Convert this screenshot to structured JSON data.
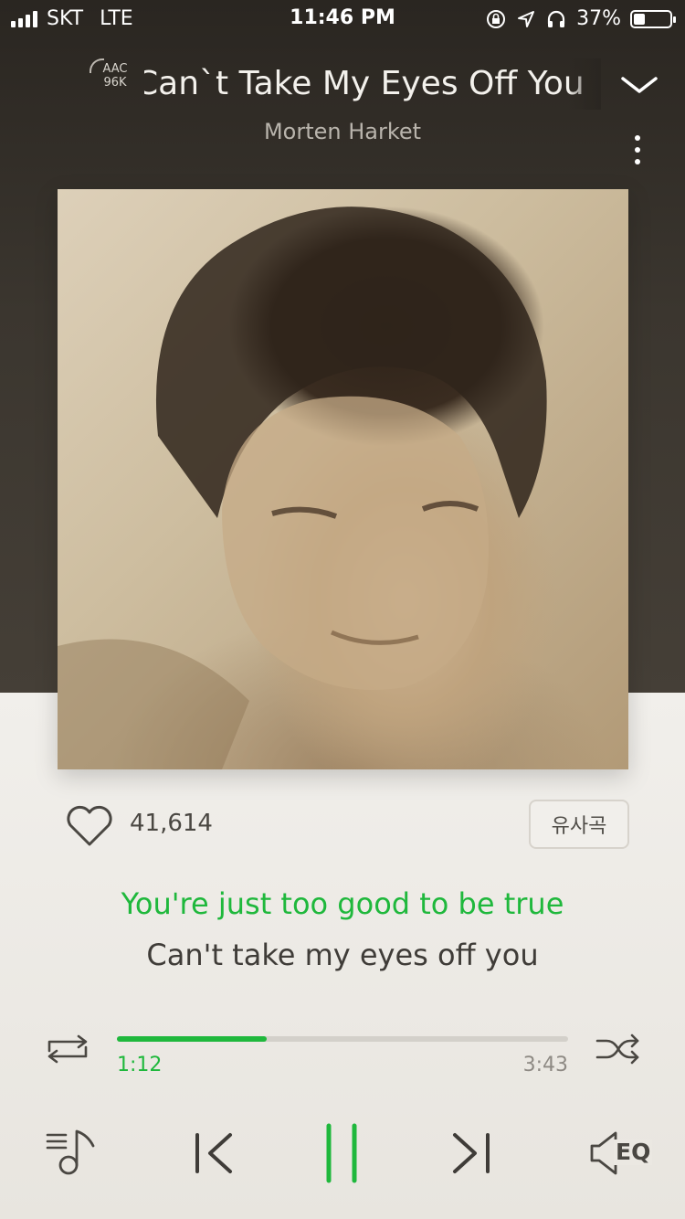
{
  "status_bar": {
    "carrier": "SKT",
    "network": "LTE",
    "time": "11:46 PM",
    "battery": "37%",
    "battery_level": 0.37,
    "icons": [
      "signal-icon",
      "rotation-lock-icon",
      "location-arrow-icon",
      "headphones-icon",
      "battery-icon"
    ]
  },
  "header": {
    "codec": "AAC",
    "bitrate": "96K",
    "title": "Can`t Take My Eyes Off You",
    "artist": "Morten Harket",
    "collapse_icon": "chevron-down-icon",
    "more_icon": "more-vertical-icon"
  },
  "actions": {
    "like_icon": "heart-icon",
    "like_count": "41,614",
    "similar_label": "유사곡"
  },
  "lyrics": {
    "current": "You're just too good to be true",
    "next": "Can't take my eyes off you"
  },
  "player": {
    "elapsed": "1:12",
    "duration": "3:43",
    "progress": 0.332,
    "repeat_icon": "repeat-icon",
    "shuffle_icon": "shuffle-icon",
    "playlist_icon": "playlist-icon",
    "prev_icon": "skip-previous-icon",
    "pause_icon": "pause-icon",
    "next_icon": "skip-next-icon",
    "eq_label": "EQ",
    "eq_icon": "speaker-icon"
  },
  "colors": {
    "accent": "#1fb83c",
    "header_bg": "#2a2621",
    "lower_bg": "#ebe8e2"
  }
}
